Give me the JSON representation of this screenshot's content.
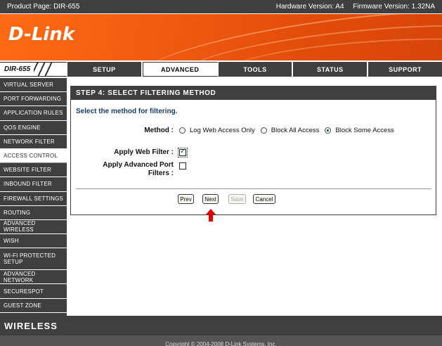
{
  "header": {
    "product_page": "Product Page: DIR-655",
    "hardware_version": "Hardware Version: A4",
    "firmware_version": "Firmware Version: 1.32NA"
  },
  "brand": {
    "logo_text": "D-Link"
  },
  "model": "DIR-655",
  "tabs": [
    "SETUP",
    "ADVANCED",
    "TOOLS",
    "STATUS",
    "SUPPORT"
  ],
  "active_tab": "ADVANCED",
  "sidebar": {
    "items": [
      "VIRTUAL SERVER",
      "PORT FORWARDING",
      "APPLICATION RULES",
      "QOS ENGINE",
      "NETWORK FILTER",
      "ACCESS CONTROL",
      "WEBSITE FILTER",
      "INBOUND FILTER",
      "FIREWALL SETTINGS",
      "ROUTING",
      "ADVANCED WIRELESS",
      "WISH",
      "WI-FI PROTECTED SETUP",
      "ADVANCED NETWORK",
      "SECURESPOT",
      "GUEST ZONE"
    ],
    "active": "ACCESS CONTROL"
  },
  "panel": {
    "title": "STEP 4: SELECT FILTERING METHOD",
    "instruction": "Select the method for filtering.",
    "method_label": "Method :",
    "options": [
      "Log Web Access Only",
      "Block All Access",
      "Block Some Access"
    ],
    "selected_option": "Block Some Access",
    "apply_web_filter_label": "Apply Web Filter :",
    "apply_web_filter_checked": true,
    "apply_port_filters_label_line1": "Apply Advanced Port",
    "apply_port_filters_label_line2": "Filters :",
    "apply_port_filters_checked": false
  },
  "buttons": {
    "prev": "Prev",
    "next": "Next",
    "save": "Save",
    "cancel": "Cancel"
  },
  "wireless_label": "WIRELESS",
  "footer": "Copyright © 2004-2008 D-Link Systems, Inc.",
  "colors": {
    "accent_orange": "#e8540c",
    "dark_gray": "#3f3f3f",
    "arrow_red": "#e00000"
  }
}
